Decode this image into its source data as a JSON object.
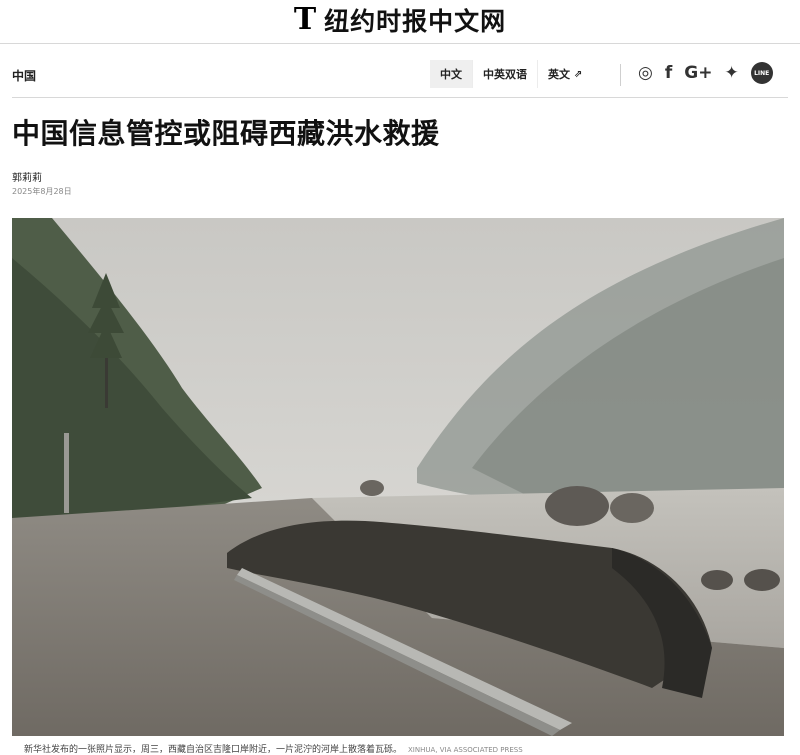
{
  "masthead": {
    "logo_mark": "T",
    "site_name": "纽约时报中文网"
  },
  "section": {
    "label": "中国"
  },
  "language_tabs": [
    {
      "label": "中文",
      "active": true
    },
    {
      "label": "中英双语",
      "active": false
    },
    {
      "label": "英文",
      "active": false,
      "external": "⇗"
    }
  ],
  "social_icons": [
    "weibo-icon",
    "facebook-icon",
    "google-plus-icon",
    "twitter-icon",
    "line-icon"
  ],
  "social": {
    "weibo": "◎",
    "facebook": "f",
    "googleplus": "G+",
    "twitter": "✦",
    "line": "LINE"
  },
  "article": {
    "headline": "中国信息管控或阻碍西藏洪水救援",
    "author": "郭莉莉",
    "date": "2025年8月28日"
  },
  "photo": {
    "caption": "新华社发布的一张照片显示，周三，西藏自治区吉隆口岸附近，一片泥泞的河岸上散落着瓦砾。",
    "credit": "XINHUA, VIA ASSOCIATED PRESS"
  }
}
